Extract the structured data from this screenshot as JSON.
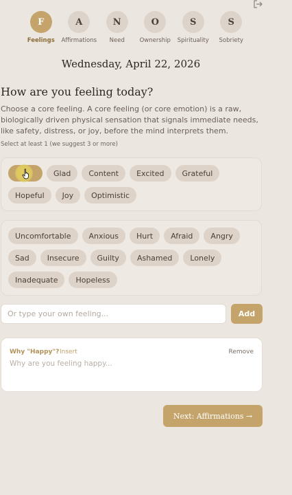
{
  "steps": [
    {
      "letter": "F",
      "label": "Feelings",
      "active": true
    },
    {
      "letter": "A",
      "label": "Affirmations",
      "active": false
    },
    {
      "letter": "N",
      "label": "Need",
      "active": false
    },
    {
      "letter": "O",
      "label": "Ownership",
      "active": false
    },
    {
      "letter": "S",
      "label": "Spirituality",
      "active": false
    },
    {
      "letter": "S",
      "label": "Sobriety",
      "active": false
    }
  ],
  "date": "Wednesday, April 22, 2026",
  "title": "How are you feeling today?",
  "description": "Choose a core feeling. A core feeling (or core emotion) is a raw, biologically driven physical sensation that signals immediate needs, like safety, distress, or joy, before the mind interprets them.",
  "hint": "Select at least 1 (we suggest 3 or more)",
  "positive_feelings": [
    {
      "label": "Happy",
      "selected": true
    },
    {
      "label": "Glad",
      "selected": false
    },
    {
      "label": "Content",
      "selected": false
    },
    {
      "label": "Excited",
      "selected": false
    },
    {
      "label": "Grateful",
      "selected": false
    },
    {
      "label": "Hopeful",
      "selected": false
    },
    {
      "label": "Joy",
      "selected": false
    },
    {
      "label": "Optimistic",
      "selected": false
    }
  ],
  "negative_feelings": [
    {
      "label": "Uncomfortable",
      "selected": false
    },
    {
      "label": "Anxious",
      "selected": false
    },
    {
      "label": "Hurt",
      "selected": false
    },
    {
      "label": "Afraid",
      "selected": false
    },
    {
      "label": "Angry",
      "selected": false
    },
    {
      "label": "Sad",
      "selected": false
    },
    {
      "label": "Insecure",
      "selected": false
    },
    {
      "label": "Guilty",
      "selected": false
    },
    {
      "label": "Ashamed",
      "selected": false
    },
    {
      "label": "Lonely",
      "selected": false
    },
    {
      "label": "Inadequate",
      "selected": false
    },
    {
      "label": "Hopeless",
      "selected": false
    }
  ],
  "custom_feeling": {
    "placeholder": "Or type your own feeling...",
    "value": "",
    "add_label": "Add"
  },
  "why_card": {
    "title": "Why \"Happy\"?",
    "insert_label": "Insert",
    "remove_label": "Remove",
    "placeholder": "Why are you feeling happy..."
  },
  "next_button": "Next: Affirmations →",
  "colors": {
    "accent": "#c4a46a",
    "chip": "#ddd3c9",
    "background": "#ece6e0"
  },
  "icons": {
    "top_right": "exit-icon",
    "cursor": "hand-pointer-icon"
  }
}
